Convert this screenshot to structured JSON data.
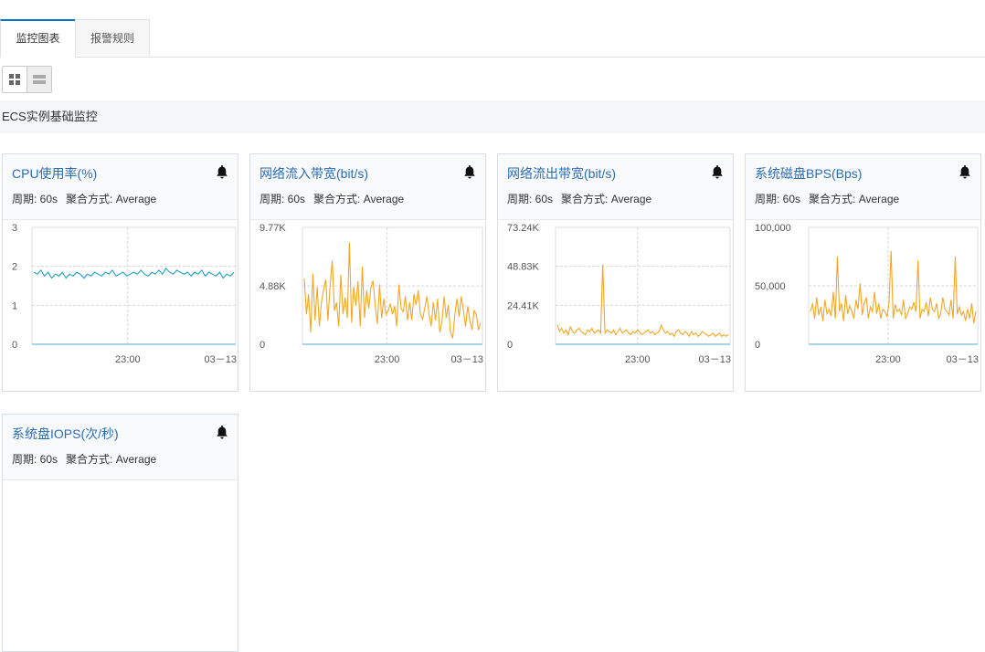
{
  "tabs": [
    {
      "label": "监控图表",
      "active": true
    },
    {
      "label": "报警规则",
      "active": false
    }
  ],
  "section_title": "ECS实例基础监控",
  "period_label": "周期: 60s",
  "agg_label": "聚合方式: Average",
  "colors": {
    "cpu": "#20a0c8",
    "net": "#f5a623",
    "axis": "#8cc6e0",
    "title": "#2a6cb3"
  },
  "charts": [
    {
      "title": "CPU使用率(%)",
      "y_ticks": [
        "3",
        "2",
        "1",
        "0"
      ],
      "x_ticks": [
        "23:00",
        "03－13"
      ],
      "chart_data": {
        "type": "line",
        "ylim": [
          0,
          3
        ],
        "y_ticks": [
          0,
          1,
          2,
          3
        ],
        "values": [
          1.85,
          1.8,
          1.9,
          1.75,
          1.85,
          1.7,
          1.8,
          1.75,
          1.85,
          1.7,
          1.8,
          1.75,
          1.85,
          1.8,
          1.7,
          1.8,
          1.75,
          1.85,
          1.8,
          1.75,
          1.85,
          1.8,
          1.9,
          1.75,
          1.8,
          1.85,
          1.75,
          1.8,
          1.85,
          1.8,
          1.9,
          1.8,
          1.75,
          1.85,
          1.8,
          1.9,
          1.8,
          1.95,
          1.85,
          1.8,
          1.9,
          1.85,
          1.8,
          1.85,
          1.75,
          1.85,
          1.8,
          1.9,
          1.75,
          1.85,
          1.8,
          1.75,
          1.85,
          1.7,
          1.8,
          1.75,
          1.85
        ]
      },
      "color": "cpu"
    },
    {
      "title": "网络流入带宽(bit/s)",
      "y_ticks": [
        "9.77K",
        "4.88K",
        "0"
      ],
      "x_ticks": [
        "23:00",
        "03－13"
      ],
      "chart_data": {
        "type": "line",
        "ylim": [
          0,
          9.77
        ],
        "y_ticks": [
          0,
          4.88,
          9.77
        ],
        "values": [
          5.5,
          2.5,
          4.2,
          1.0,
          5.9,
          2.0,
          4.8,
          1.5,
          3.5,
          4.6,
          5.4,
          2.0,
          4.8,
          7.0,
          2.8,
          3.5,
          1.5,
          5.8,
          2.5,
          3.9,
          2.2,
          8.5,
          1.8,
          4.8,
          3.2,
          5.3,
          1.5,
          6.5,
          2.2,
          4.5,
          3.0,
          4.8,
          5.3,
          3.2,
          1.7,
          5.0,
          2.2,
          3.8,
          2.5,
          2.8,
          3.4,
          2.5,
          3.2,
          1.5,
          5.0,
          3.0,
          2.7,
          4.0,
          2.0,
          3.5,
          2.0,
          4.2,
          3.3,
          4.5,
          2.5,
          2.1,
          3.0,
          4.0,
          2.5,
          1.5,
          3.5,
          2.0,
          3.8,
          1.0,
          1.8,
          4.0,
          2.2,
          3.3,
          1.0,
          0.5,
          2.5,
          3.8,
          2.3,
          4.0,
          2.8,
          1.5,
          3.2,
          2.0,
          1.2,
          2.8,
          2.5,
          1.2,
          1.8
        ]
      },
      "color": "net"
    },
    {
      "title": "网络流出带宽(bit/s)",
      "y_ticks": [
        "73.24K",
        "48.83K",
        "24.41K",
        "0"
      ],
      "x_ticks": [
        "23:00",
        "03－13"
      ],
      "chart_data": {
        "type": "line",
        "ylim": [
          0,
          73.24
        ],
        "y_ticks": [
          0,
          24.41,
          48.83,
          73.24
        ],
        "values": [
          12,
          8,
          10,
          7,
          9,
          6,
          11,
          8,
          7,
          9,
          10,
          8,
          7,
          6,
          9,
          8,
          10,
          7,
          8,
          9,
          7,
          50,
          7,
          9,
          8,
          7,
          9,
          6,
          8,
          10,
          7,
          8,
          9,
          7,
          6,
          8,
          7,
          9,
          8,
          6,
          7,
          8,
          9,
          7,
          8,
          6,
          7,
          8,
          12,
          9,
          7,
          8,
          6,
          7,
          5,
          8,
          9,
          7,
          6,
          8,
          7,
          5,
          8,
          6,
          7,
          5,
          6,
          8,
          7,
          6,
          5,
          6,
          7,
          5,
          6,
          7,
          5,
          6,
          5,
          6
        ]
      },
      "color": "net"
    },
    {
      "title": "系统磁盘BPS(Bps)",
      "y_ticks": [
        "100,000",
        "50,000",
        "0"
      ],
      "x_ticks": [
        "23:00",
        "03－13"
      ],
      "chart_data": {
        "type": "line",
        "ylim": [
          0,
          100000
        ],
        "y_ticks": [
          0,
          50000,
          100000
        ],
        "values": [
          28000,
          35000,
          22000,
          40000,
          25000,
          32000,
          20000,
          38000,
          26000,
          30000,
          24000,
          45000,
          22000,
          75000,
          28000,
          35000,
          20000,
          42000,
          26000,
          33000,
          28000,
          22000,
          38000,
          30000,
          52000,
          25000,
          35000,
          40000,
          22000,
          32000,
          28000,
          45000,
          26000,
          35000,
          22000,
          30000,
          28000,
          24000,
          35000,
          80000,
          22000,
          34000,
          28000,
          30000,
          25000,
          38000,
          22000,
          26000,
          32000,
          30000,
          36000,
          28000,
          72000,
          22000,
          30000,
          28000,
          36000,
          24000,
          40000,
          30000,
          28000,
          35000,
          22000,
          26000,
          40000,
          30000,
          28000,
          25000,
          38000,
          22000,
          75000,
          26000,
          32000,
          25000,
          28000,
          20000,
          30000,
          22000,
          35000,
          18000,
          28000
        ]
      },
      "color": "net"
    },
    {
      "title": "系统盘IOPS(次/秒)",
      "y_ticks": [],
      "x_ticks": [],
      "chart_data": {
        "type": "line",
        "ylim": [
          0,
          1
        ],
        "values": []
      },
      "color": "net"
    }
  ]
}
